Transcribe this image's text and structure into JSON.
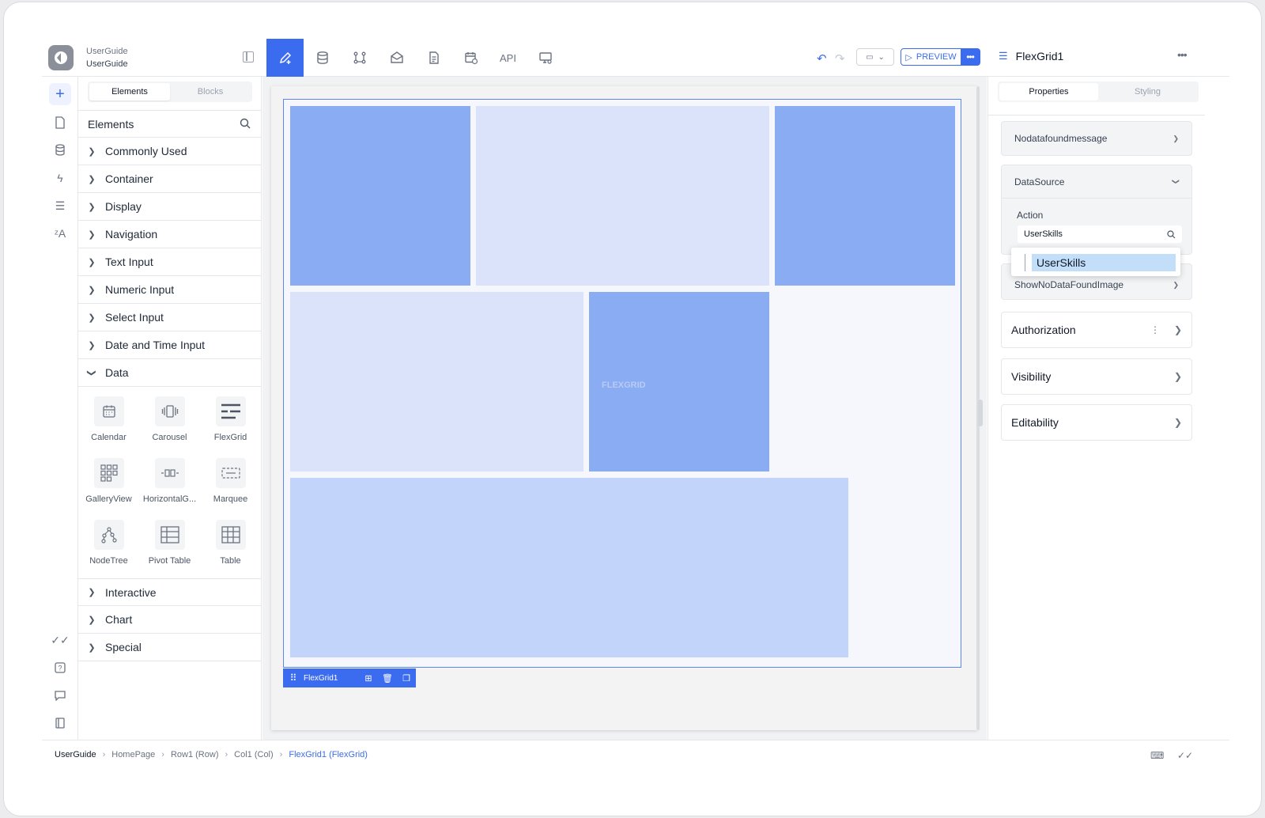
{
  "project": {
    "line1": "UserGuide",
    "line2": "UserGuide"
  },
  "toolbar": {
    "api_label": "API",
    "preview_label": "PREVIEW"
  },
  "left_panel": {
    "tabs": [
      "Elements",
      "Blocks"
    ],
    "header": "Elements",
    "categories_top": [
      "Commonly Used",
      "Container",
      "Display",
      "Navigation",
      "Text Input",
      "Numeric Input",
      "Select Input",
      "Date and Time Input",
      "Data"
    ],
    "data_items": [
      "Calendar",
      "Carousel",
      "FlexGrid",
      "GalleryView",
      "HorizontalG...",
      "Marquee",
      "NodeTree",
      "Pivot Table",
      "Table"
    ],
    "categories_bottom": [
      "Interactive",
      "Chart",
      "Special"
    ]
  },
  "canvas": {
    "flexgrid_watermark": "FLEXGRID",
    "selected_label": "FlexGrid1"
  },
  "right_panel": {
    "title": "FlexGrid1",
    "tabs": [
      "Properties",
      "Styling"
    ],
    "nodata": "Nodatafoundmessage",
    "datasource": "DataSource",
    "action_label": "Action",
    "action_value": "UserSkills",
    "dropdown_option": "UserSkills",
    "shownodata": "ShowNoDataFoundImage",
    "authorization": "Authorization",
    "visibility": "Visibility",
    "editability": "Editability"
  },
  "breadcrumb": [
    "UserGuide",
    "HomePage",
    "Row1 (Row)",
    "Col1 (Col)",
    "FlexGrid1 (FlexGrid)"
  ]
}
